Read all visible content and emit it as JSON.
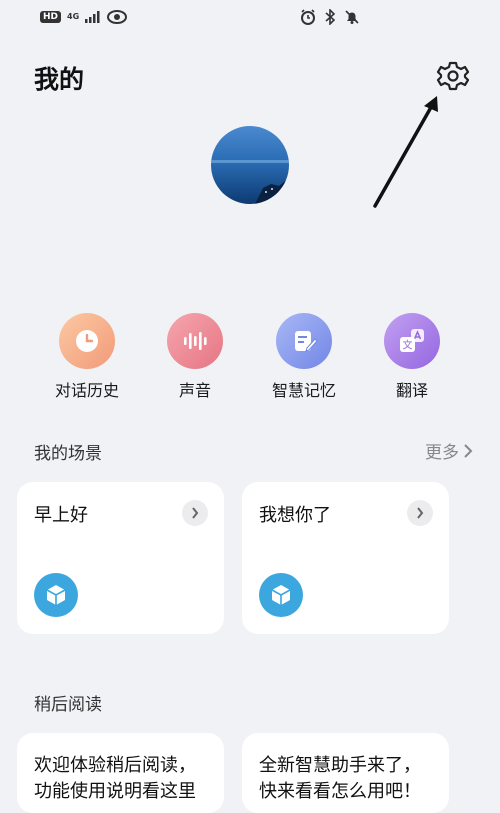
{
  "status_bar": {
    "hd": "HD",
    "network": "4G",
    "icons": [
      "signal-icon",
      "eye-icon",
      "alarm-icon",
      "bluetooth-icon",
      "mute-icon"
    ]
  },
  "header": {
    "title": "我的",
    "settings_icon": "gear-icon"
  },
  "profile": {
    "avatar": "avatar"
  },
  "quick_actions": [
    {
      "label": "对话历史",
      "icon": "clock-icon",
      "color": "#f6b18a"
    },
    {
      "label": "声音",
      "icon": "sound-wave-icon",
      "color": "#ee8e98"
    },
    {
      "label": "智慧记忆",
      "icon": "note-pen-icon",
      "color": "#8fa2ef"
    },
    {
      "label": "翻译",
      "icon": "translate-icon",
      "color": "#a884e8"
    }
  ],
  "scenes": {
    "title": "我的场景",
    "more_label": "更多",
    "cards": [
      {
        "title": "早上好"
      },
      {
        "title": "我想你了"
      }
    ]
  },
  "read_later": {
    "title": "稍后阅读",
    "cards": [
      {
        "text": "欢迎体验稍后阅读，功能使用说明看这里"
      },
      {
        "text": "全新智慧助手来了，快来看看怎么用吧！"
      }
    ]
  },
  "colors": {
    "background": "#f1f2f6",
    "cube": "#3ba7de"
  }
}
